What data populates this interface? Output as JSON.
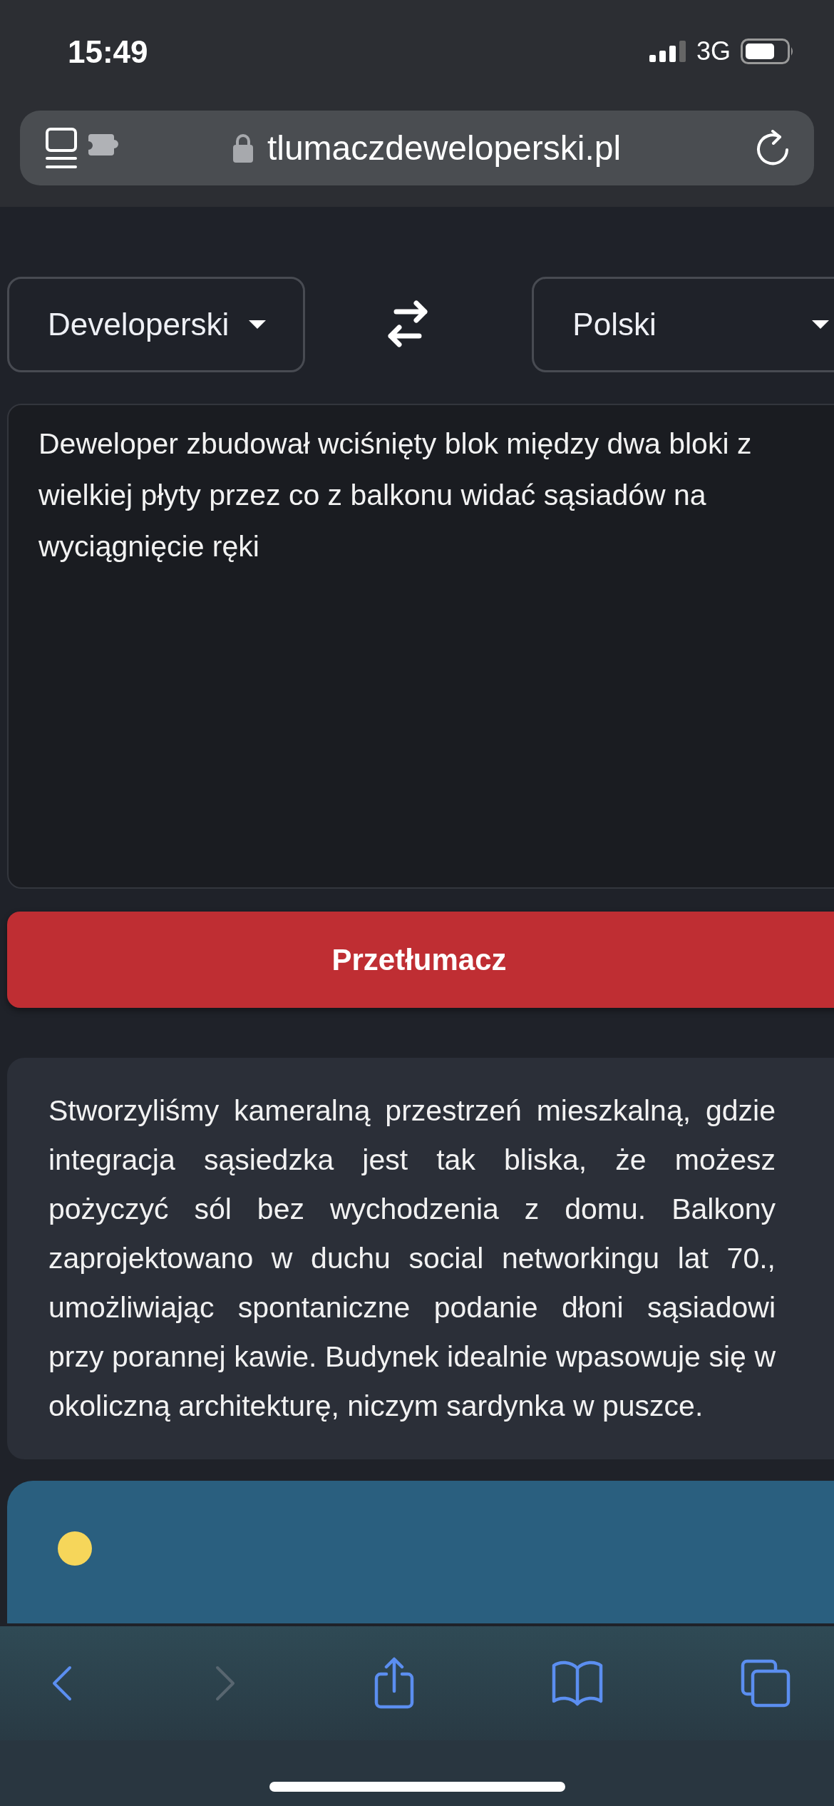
{
  "status_bar": {
    "time": "15:49",
    "network": "3G"
  },
  "address_bar": {
    "url": "tlumaczdeweloperski.pl"
  },
  "translator": {
    "source_language": "Developerski",
    "target_language": "Polski",
    "input_text": "Deweloper zbudował wciśnięty blok między dwa bloki z wielkiej płyty przez co z balkonu widać sąsiadów na wyciągnięcie ręki",
    "translate_button": "Przetłumacz",
    "result_text": "Stworzyliśmy kameralną przestrzeń mieszkalną, gdzie integracja sąsiedzka jest tak bliska, że możesz pożyczyć sól bez wychodzenia z domu. Balkony zaprojektowano w duchu social networkingu lat 70., umożliwiając spontaniczne podanie dłoni sąsiadowi przy porannej kawie. Budynek idealnie wpasowuje się w okoliczną architekturę, niczym sardynka w puszce."
  },
  "toolbar": [
    {
      "kind": "back",
      "disabled": false
    },
    {
      "kind": "forward",
      "disabled": true
    },
    {
      "kind": "share",
      "disabled": false
    },
    {
      "kind": "bookmarks",
      "disabled": false
    },
    {
      "kind": "tabs",
      "disabled": false
    }
  ]
}
